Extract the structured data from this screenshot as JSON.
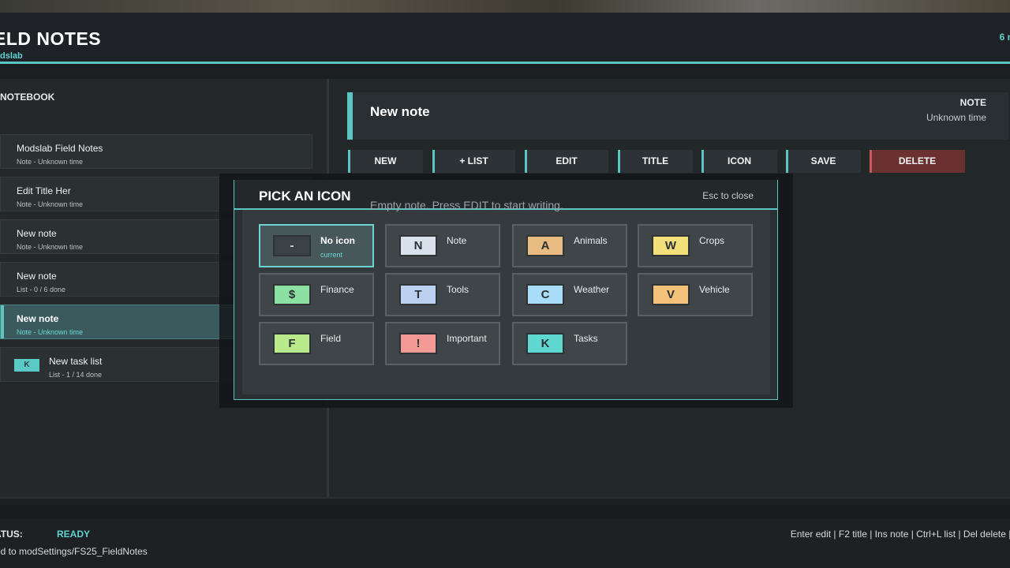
{
  "app": {
    "title": "ELD NOTES",
    "subtitle": "dslab",
    "header_right": "6 n"
  },
  "notebook": {
    "heading": "NOTEBOOK",
    "items": [
      {
        "title": "Modslab Field Notes",
        "sub": "Note - Unknown time",
        "selected": false
      },
      {
        "title": "Edit Title Her",
        "sub": "Note - Unknown time",
        "selected": false
      },
      {
        "title": "New note",
        "sub": "Note - Unknown time",
        "selected": false
      },
      {
        "title": "New note",
        "sub": "List - 0 / 6 done",
        "selected": false
      },
      {
        "title": "New note",
        "sub": "Note - Unknown time",
        "selected": true
      },
      {
        "title": "New task list",
        "sub": "List - 1 / 14 done",
        "icon": "K",
        "selected": false
      }
    ]
  },
  "note": {
    "title": "New note",
    "kind": "NOTE",
    "time": "Unknown time",
    "empty_text": "Empty note. Press EDIT to start writing."
  },
  "toolbar": {
    "new": "NEW",
    "list": "+ LIST",
    "edit": "EDIT",
    "title": "TITLE",
    "icon": "ICON",
    "save": "SAVE",
    "delete": "DELETE"
  },
  "modal": {
    "title": "PICK AN ICON",
    "esc_hint": "Esc to close",
    "current_label": "current",
    "options": [
      {
        "letter": "-",
        "label": "No icon",
        "color": "#3b4245",
        "selected": true
      },
      {
        "letter": "N",
        "label": "Note",
        "color": "#d9e2ec",
        "selected": false
      },
      {
        "letter": "A",
        "label": "Animals",
        "color": "#e8bb82",
        "selected": false
      },
      {
        "letter": "W",
        "label": "Crops",
        "color": "#f3e07a",
        "selected": false
      },
      {
        "letter": "$",
        "label": "Finance",
        "color": "#8be0a2",
        "selected": false
      },
      {
        "letter": "T",
        "label": "Tools",
        "color": "#bcd0f2",
        "selected": false
      },
      {
        "letter": "C",
        "label": "Weather",
        "color": "#a8dcf7",
        "selected": false
      },
      {
        "letter": "V",
        "label": "Vehicle",
        "color": "#f5c27c",
        "selected": false
      },
      {
        "letter": "F",
        "label": "Field",
        "color": "#b8ea8c",
        "selected": false
      },
      {
        "letter": "!",
        "label": "Important",
        "color": "#f39a96",
        "selected": false
      },
      {
        "letter": "K",
        "label": "Tasks",
        "color": "#5fd8d2",
        "selected": false
      }
    ]
  },
  "status": {
    "label": "ATUS:",
    "value": "READY",
    "path": "ed to modSettings/FS25_FieldNotes",
    "hint": "Enter edit | F2 title | Ins note | Ctrl+L list | Del delete | I"
  },
  "colors": {
    "accent": "#5cc5c2",
    "delete": "#6b3130"
  }
}
